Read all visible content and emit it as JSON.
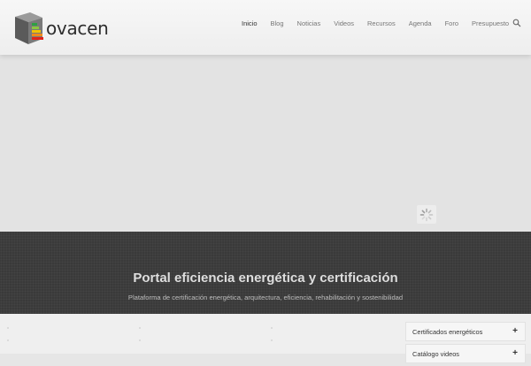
{
  "brand": {
    "name": "ovacen"
  },
  "nav": {
    "items": [
      {
        "label": "Inicio",
        "active": true
      },
      {
        "label": "Blog",
        "active": false
      },
      {
        "label": "Noticias",
        "active": false
      },
      {
        "label": "Videos",
        "active": false
      },
      {
        "label": "Recursos",
        "active": false
      },
      {
        "label": "Agenda",
        "active": false
      },
      {
        "label": "Foro",
        "active": false
      },
      {
        "label": "Presupuesto",
        "active": false
      }
    ],
    "search_icon": "search-icon"
  },
  "hero": {
    "loader_icon": "spinner-icon"
  },
  "banner": {
    "title": "Portal eficiencia energética y certificación",
    "subtitle": "Plataforma de certificación energética, arquitectura, eficiencia, rehabilitación y sostenibilidad"
  },
  "sidebar": {
    "accordion": [
      {
        "label": "Certificados energéticos",
        "icon": "plus-icon"
      },
      {
        "label": "Catálogo videos",
        "icon": "plus-icon"
      }
    ]
  },
  "colors": {
    "banner_bg": "#3a3a3a",
    "header_bg": "#f3f3f3",
    "hero_bg": "#e3e3e3"
  }
}
